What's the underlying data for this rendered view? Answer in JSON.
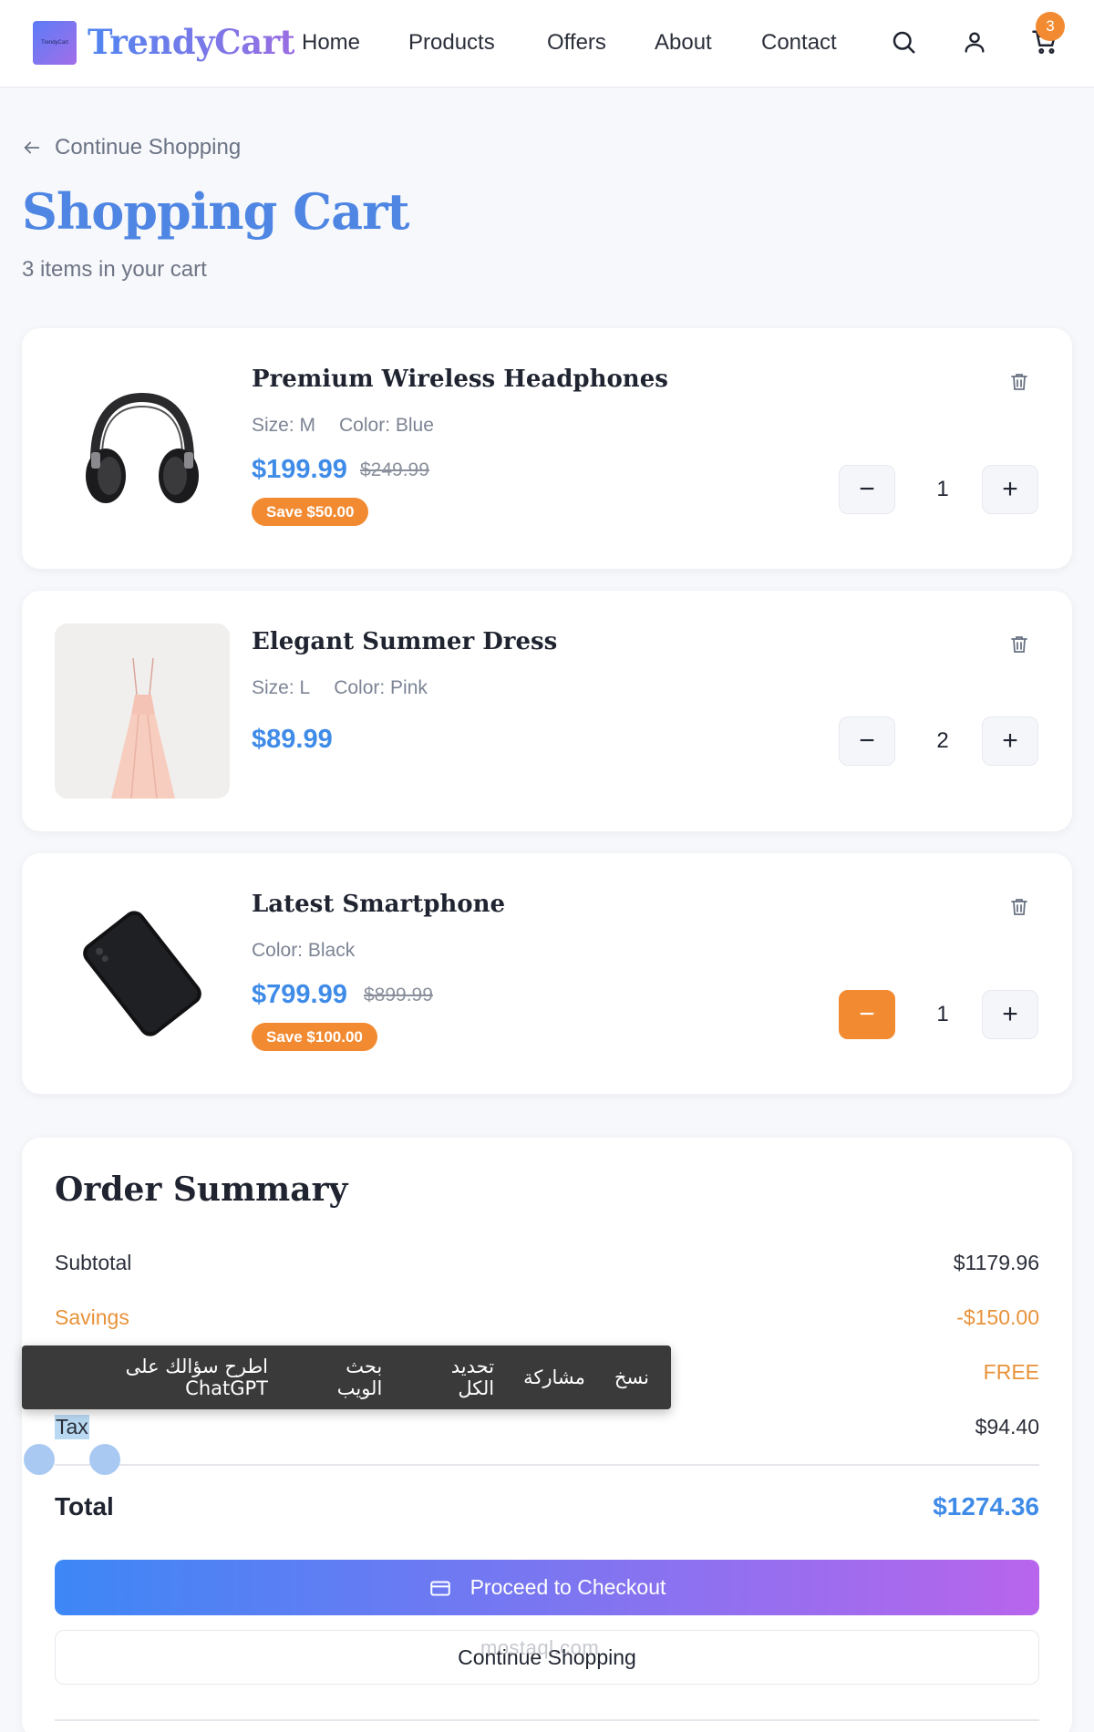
{
  "header": {
    "logo_mini": "TrendyCart",
    "brand": "TrendyCart",
    "nav": [
      "Home",
      "Products",
      "Offers",
      "About",
      "Contact"
    ],
    "cart_count": "3"
  },
  "page": {
    "back_label": "Continue Shopping",
    "title": "Shopping Cart",
    "item_count": "3 items in your cart"
  },
  "items": [
    {
      "name": "Premium Wireless Headphones",
      "size": "Size: M",
      "color": "Color: Blue",
      "price": "$199.99",
      "old_price": "$249.99",
      "save": "Save $50.00",
      "qty": "1"
    },
    {
      "name": "Elegant Summer Dress",
      "size": "Size: L",
      "color": "Color: Pink",
      "price": "$89.99",
      "qty": "2"
    },
    {
      "name": "Latest Smartphone",
      "color": "Color: Black",
      "price": "$799.99",
      "old_price": "$899.99",
      "save": "Save $100.00",
      "qty": "1"
    }
  ],
  "summary": {
    "title": "Order Summary",
    "subtotal_label": "Subtotal",
    "subtotal": "$1179.96",
    "savings_label": "Savings",
    "savings": "-$150.00",
    "shipping": "FREE",
    "tax_label": "Tax",
    "tax": "$94.40",
    "total_label": "Total",
    "total": "$1274.36",
    "checkout_label": "Proceed to Checkout",
    "continue_label": "Continue Shopping"
  },
  "context_menu": [
    "نسخ",
    "مشاركة",
    "تحديد الكل",
    "بحث الويب",
    "اطرح سؤالك على ChatGPT"
  ],
  "watermark": "mostaql.com",
  "colors": {
    "accent": "#3f8be8",
    "orange": "#f28a31",
    "brand_gradient": [
      "#5b7cf6",
      "#a36ee9"
    ]
  }
}
